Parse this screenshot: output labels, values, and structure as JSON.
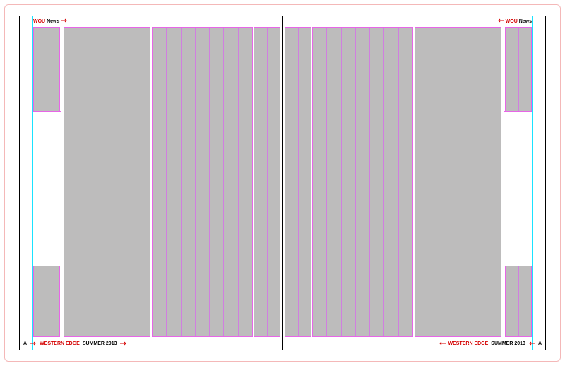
{
  "header": {
    "brand": "WOU",
    "section": "News"
  },
  "footer": {
    "page_number": "A",
    "publication": "WESTERN EDGE",
    "issue": "SUMMER 2013"
  },
  "layout": {
    "columns_small": 2,
    "columns_small2": 1,
    "columns_mid": 6,
    "columns_big": 7
  }
}
